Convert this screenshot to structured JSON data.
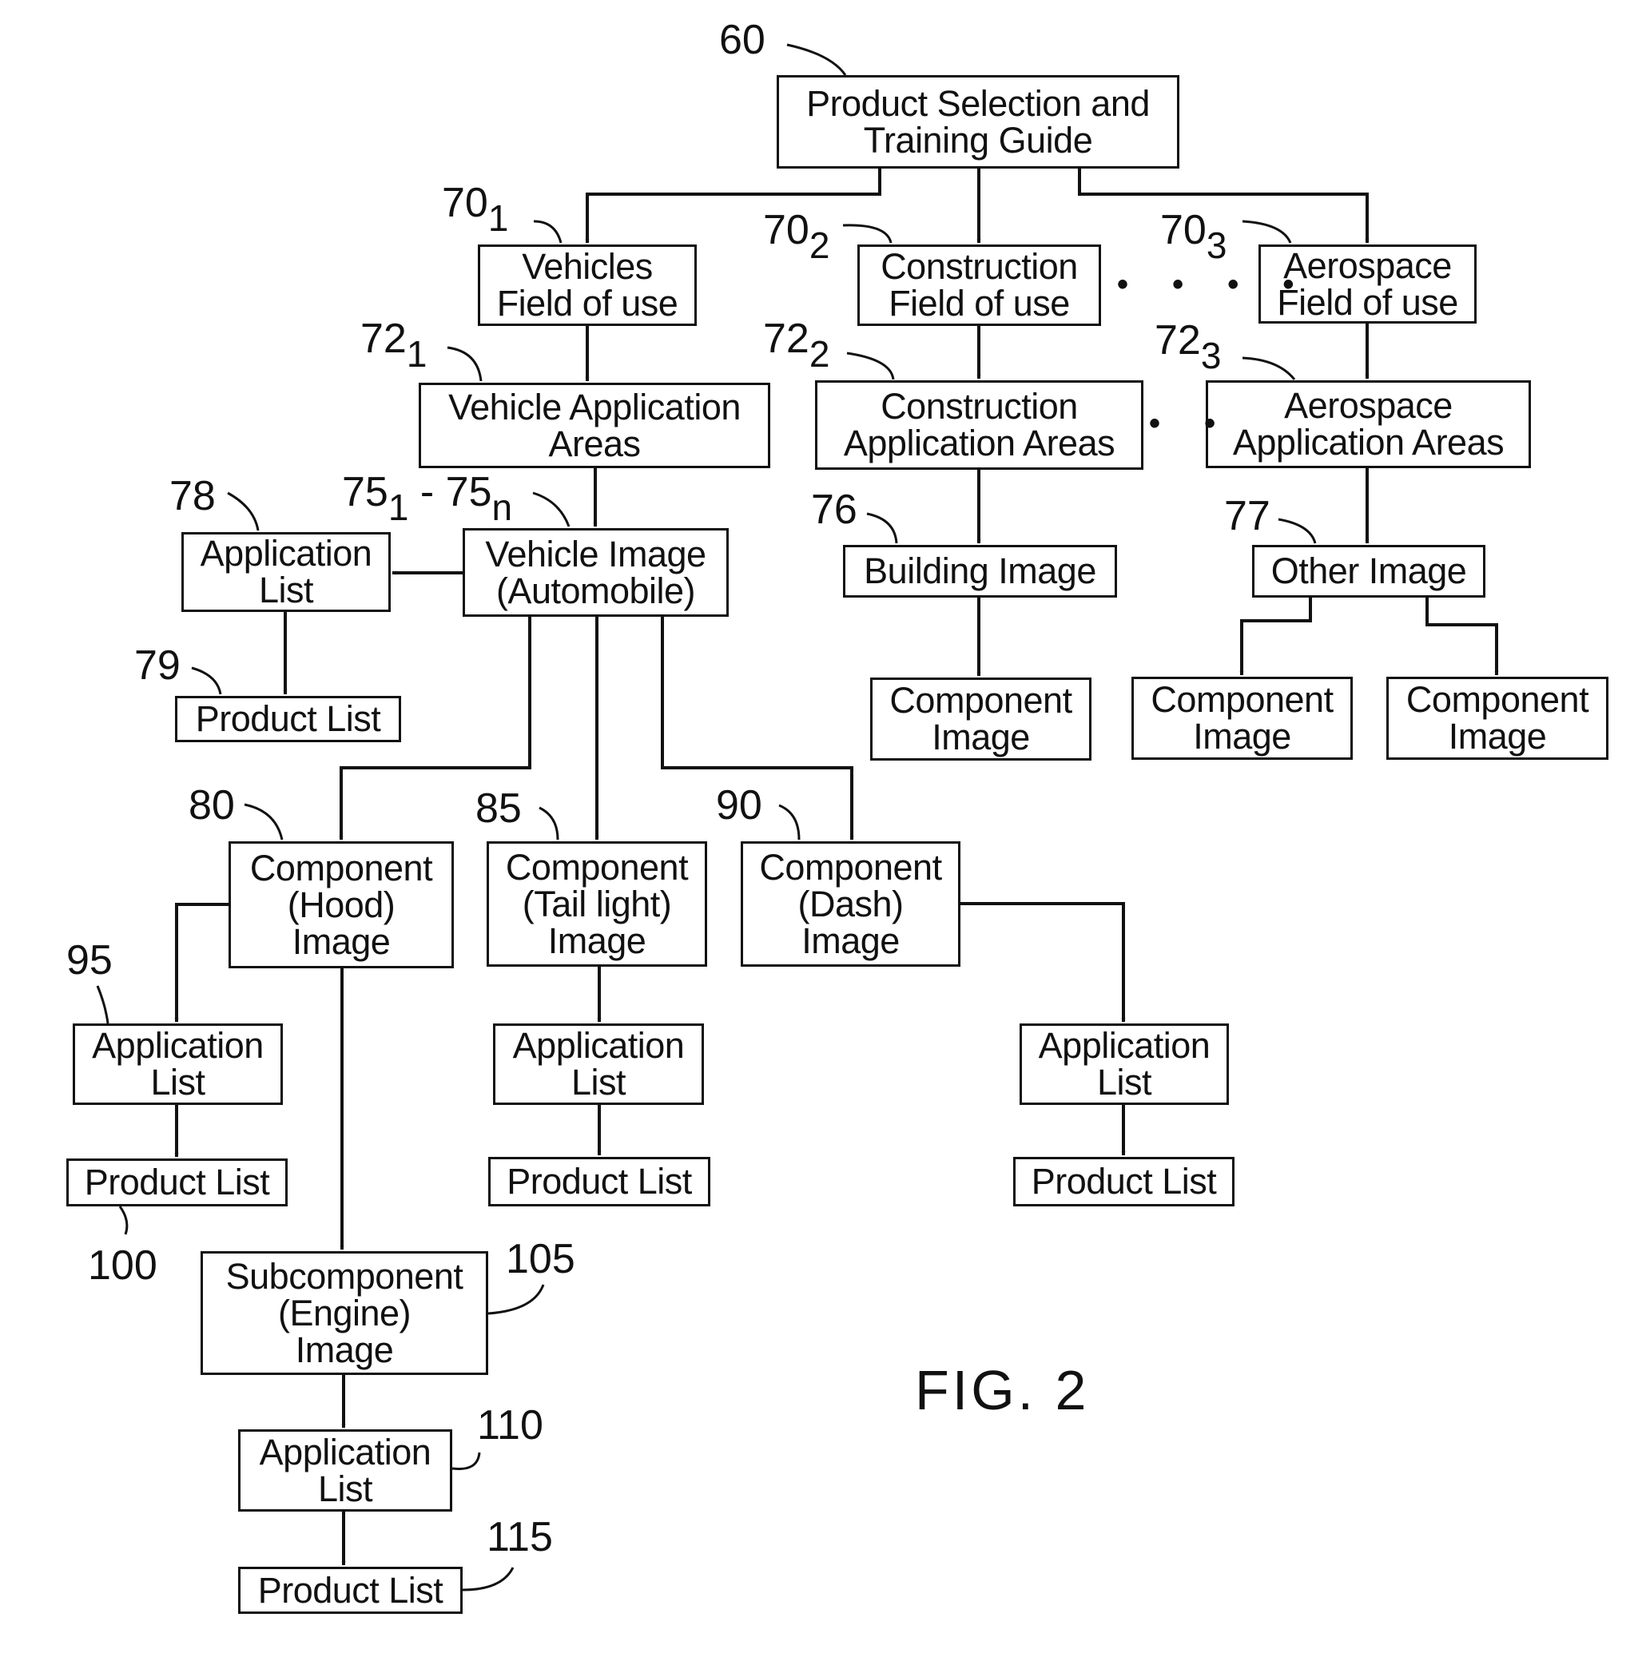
{
  "figure_label": "FIG. 2",
  "nodes": {
    "root": {
      "ref": "60",
      "text": "Product Selection and\nTraining Guide"
    },
    "vehicles_field": {
      "ref": "70",
      "ref_sub": "1",
      "text": "Vehicles\nField of use"
    },
    "construction_field": {
      "ref": "70",
      "ref_sub": "2",
      "text": "Construction\nField of use"
    },
    "aerospace_field": {
      "ref": "70",
      "ref_sub": "3",
      "text": "Aerospace\nField of use"
    },
    "vehicle_app_areas": {
      "ref": "72",
      "ref_sub": "1",
      "text": "Vehicle Application\nAreas"
    },
    "construction_app_areas": {
      "ref": "72",
      "ref_sub": "2",
      "text": "Construction\nApplication Areas"
    },
    "aerospace_app_areas": {
      "ref": "72",
      "ref_sub": "3",
      "text": "Aerospace\nApplication Areas"
    },
    "vehicle_image": {
      "ref": "75",
      "ref_sub": "1",
      "ref_sep": " - 75",
      "ref_sub2": "n",
      "text": "Vehicle Image\n(Automobile)"
    },
    "vehicle_app_list": {
      "ref": "78",
      "text": "Application\nList"
    },
    "vehicle_product_list": {
      "ref": "79",
      "text": "Product List"
    },
    "building_image": {
      "ref": "76",
      "text": "Building Image"
    },
    "other_image": {
      "ref": "77",
      "text": "Other Image"
    },
    "building_component_image": {
      "text": "Component\nImage"
    },
    "other_component_image_1": {
      "text": "Component\nImage"
    },
    "other_component_image_2": {
      "text": "Component\nImage"
    },
    "hood_component": {
      "ref": "80",
      "text": "Component\n(Hood)\nImage"
    },
    "taillight_component": {
      "ref": "85",
      "text": "Component\n(Tail light)\nImage"
    },
    "dash_component": {
      "ref": "90",
      "text": "Component\n(Dash)\nImage"
    },
    "hood_app_list": {
      "ref": "95",
      "text": "Application\nList"
    },
    "hood_product_list": {
      "ref": "100",
      "text": "Product List"
    },
    "taillight_app_list": {
      "text": "Application\nList"
    },
    "taillight_product_list": {
      "text": "Product List"
    },
    "dash_app_list": {
      "text": "Application\nList"
    },
    "dash_product_list": {
      "text": "Product List"
    },
    "engine_subcomponent": {
      "ref": "105",
      "text": "Subcomponent\n(Engine)\nImage"
    },
    "engine_app_list": {
      "ref": "110",
      "text": "Application\nList"
    },
    "engine_product_list": {
      "ref": "115",
      "text": "Product List"
    }
  },
  "ellipsis": {
    "fields": "• • • •",
    "areas": "• •"
  }
}
